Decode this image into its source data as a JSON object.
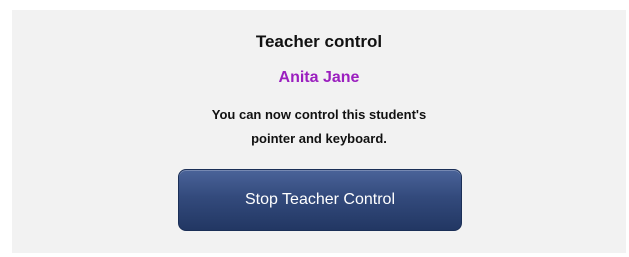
{
  "dialog": {
    "title": "Teacher control",
    "student_name": "Anita Jane",
    "message_line1": "You can now control this student's",
    "message_line2": "pointer and keyboard.",
    "stop_button_label": "Stop Teacher Control"
  },
  "colors": {
    "student_name": "#9b1fbf",
    "button_bg": "#2e4475",
    "panel_bg": "#f2f2f2"
  }
}
